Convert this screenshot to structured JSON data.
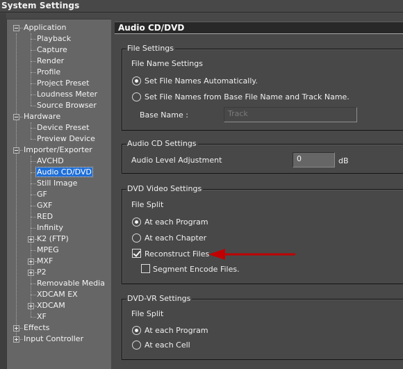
{
  "window": {
    "title": "System Settings"
  },
  "tree": {
    "items": [
      {
        "label": "Application",
        "level": 0,
        "expander": "minus"
      },
      {
        "label": "Playback",
        "level": 1
      },
      {
        "label": "Capture",
        "level": 1
      },
      {
        "label": "Render",
        "level": 1
      },
      {
        "label": "Profile",
        "level": 1
      },
      {
        "label": "Project Preset",
        "level": 1
      },
      {
        "label": "Loudness Meter",
        "level": 1
      },
      {
        "label": "Source Browser",
        "level": 1
      },
      {
        "label": "Hardware",
        "level": 0,
        "expander": "minus"
      },
      {
        "label": "Device Preset",
        "level": 1
      },
      {
        "label": "Preview Device",
        "level": 1
      },
      {
        "label": "Importer/Exporter",
        "level": 0,
        "expander": "minus"
      },
      {
        "label": "AVCHD",
        "level": 1
      },
      {
        "label": "Audio CD/DVD",
        "level": 1,
        "selected": true
      },
      {
        "label": "Still Image",
        "level": 1
      },
      {
        "label": "GF",
        "level": 1
      },
      {
        "label": "GXF",
        "level": 1
      },
      {
        "label": "RED",
        "level": 1
      },
      {
        "label": "Infinity",
        "level": 1
      },
      {
        "label": "K2 (FTP)",
        "level": 1,
        "expander": "plus"
      },
      {
        "label": "MPEG",
        "level": 1
      },
      {
        "label": "MXF",
        "level": 1,
        "expander": "plus"
      },
      {
        "label": "P2",
        "level": 1,
        "expander": "plus"
      },
      {
        "label": "Removable Media",
        "level": 1
      },
      {
        "label": "XDCAM EX",
        "level": 1
      },
      {
        "label": "XDCAM",
        "level": 1,
        "expander": "plus"
      },
      {
        "label": "XF",
        "level": 1
      },
      {
        "label": "Effects",
        "level": 0,
        "expander": "plus"
      },
      {
        "label": "Input Controller",
        "level": 0,
        "expander": "plus"
      }
    ]
  },
  "panel": {
    "title": "Audio CD/DVD",
    "file_settings": {
      "legend": "File Settings",
      "subheading": "File Name Settings",
      "option_auto": "Set File Names Automatically.",
      "option_auto_selected": true,
      "option_base": "Set File Names from Base File Name and Track Name.",
      "option_base_selected": false,
      "base_name_label": "Base Name :",
      "base_name_value": "Track",
      "base_name_enabled": false
    },
    "audio_cd": {
      "legend": "Audio CD Settings",
      "level_label": "Audio Level Adjustment",
      "level_value": "0",
      "level_unit": "dB"
    },
    "dvd_video": {
      "legend": "DVD Video Settings",
      "subheading": "File Split",
      "option_program": "At each Program",
      "option_program_selected": true,
      "option_chapter": "At each Chapter",
      "option_chapter_selected": false,
      "reconstruct_label": "Reconstruct Files",
      "reconstruct_checked": true,
      "segment_label": "Segment Encode Files.",
      "segment_checked": false
    },
    "dvd_vr": {
      "legend": "DVD-VR Settings",
      "subheading": "File Split",
      "option_program": "At each Program",
      "option_program_selected": true,
      "option_cell": "At each Cell",
      "option_cell_selected": false
    }
  },
  "annotation": {
    "arrow_color": "#c00000",
    "points_to": "Reconstruct Files"
  }
}
